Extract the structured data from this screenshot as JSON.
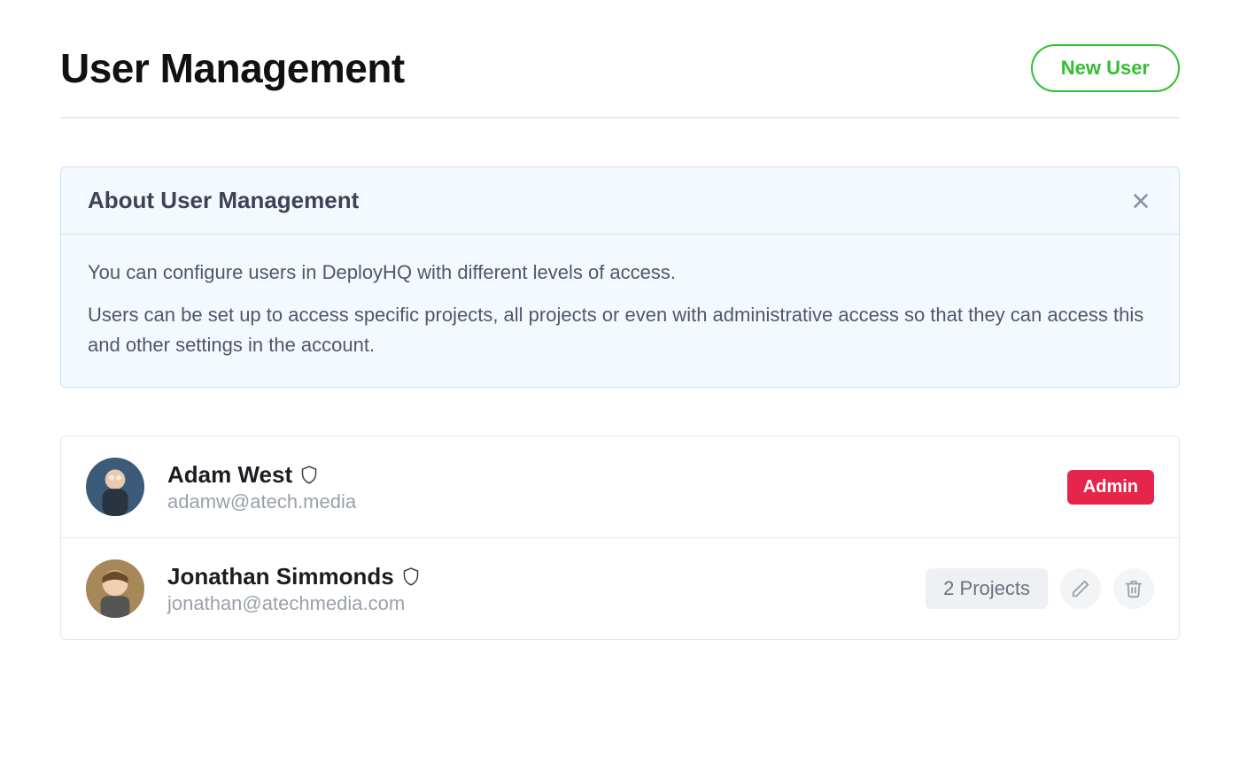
{
  "header": {
    "title": "User Management",
    "new_user_label": "New User"
  },
  "info": {
    "title": "About User Management",
    "p1": "You can configure users in DeployHQ with different levels of access.",
    "p2": "Users can be set up to access specific projects, all projects or even with administrative access so that they can access this and other settings in the account."
  },
  "users": [
    {
      "name": "Adam West",
      "email": "adamw@atech.media",
      "role_badge": "Admin",
      "is_admin": true
    },
    {
      "name": "Jonathan Simmonds",
      "email": "jonathan@atechmedia.com",
      "projects_label": "2 Projects",
      "is_admin": false
    }
  ]
}
